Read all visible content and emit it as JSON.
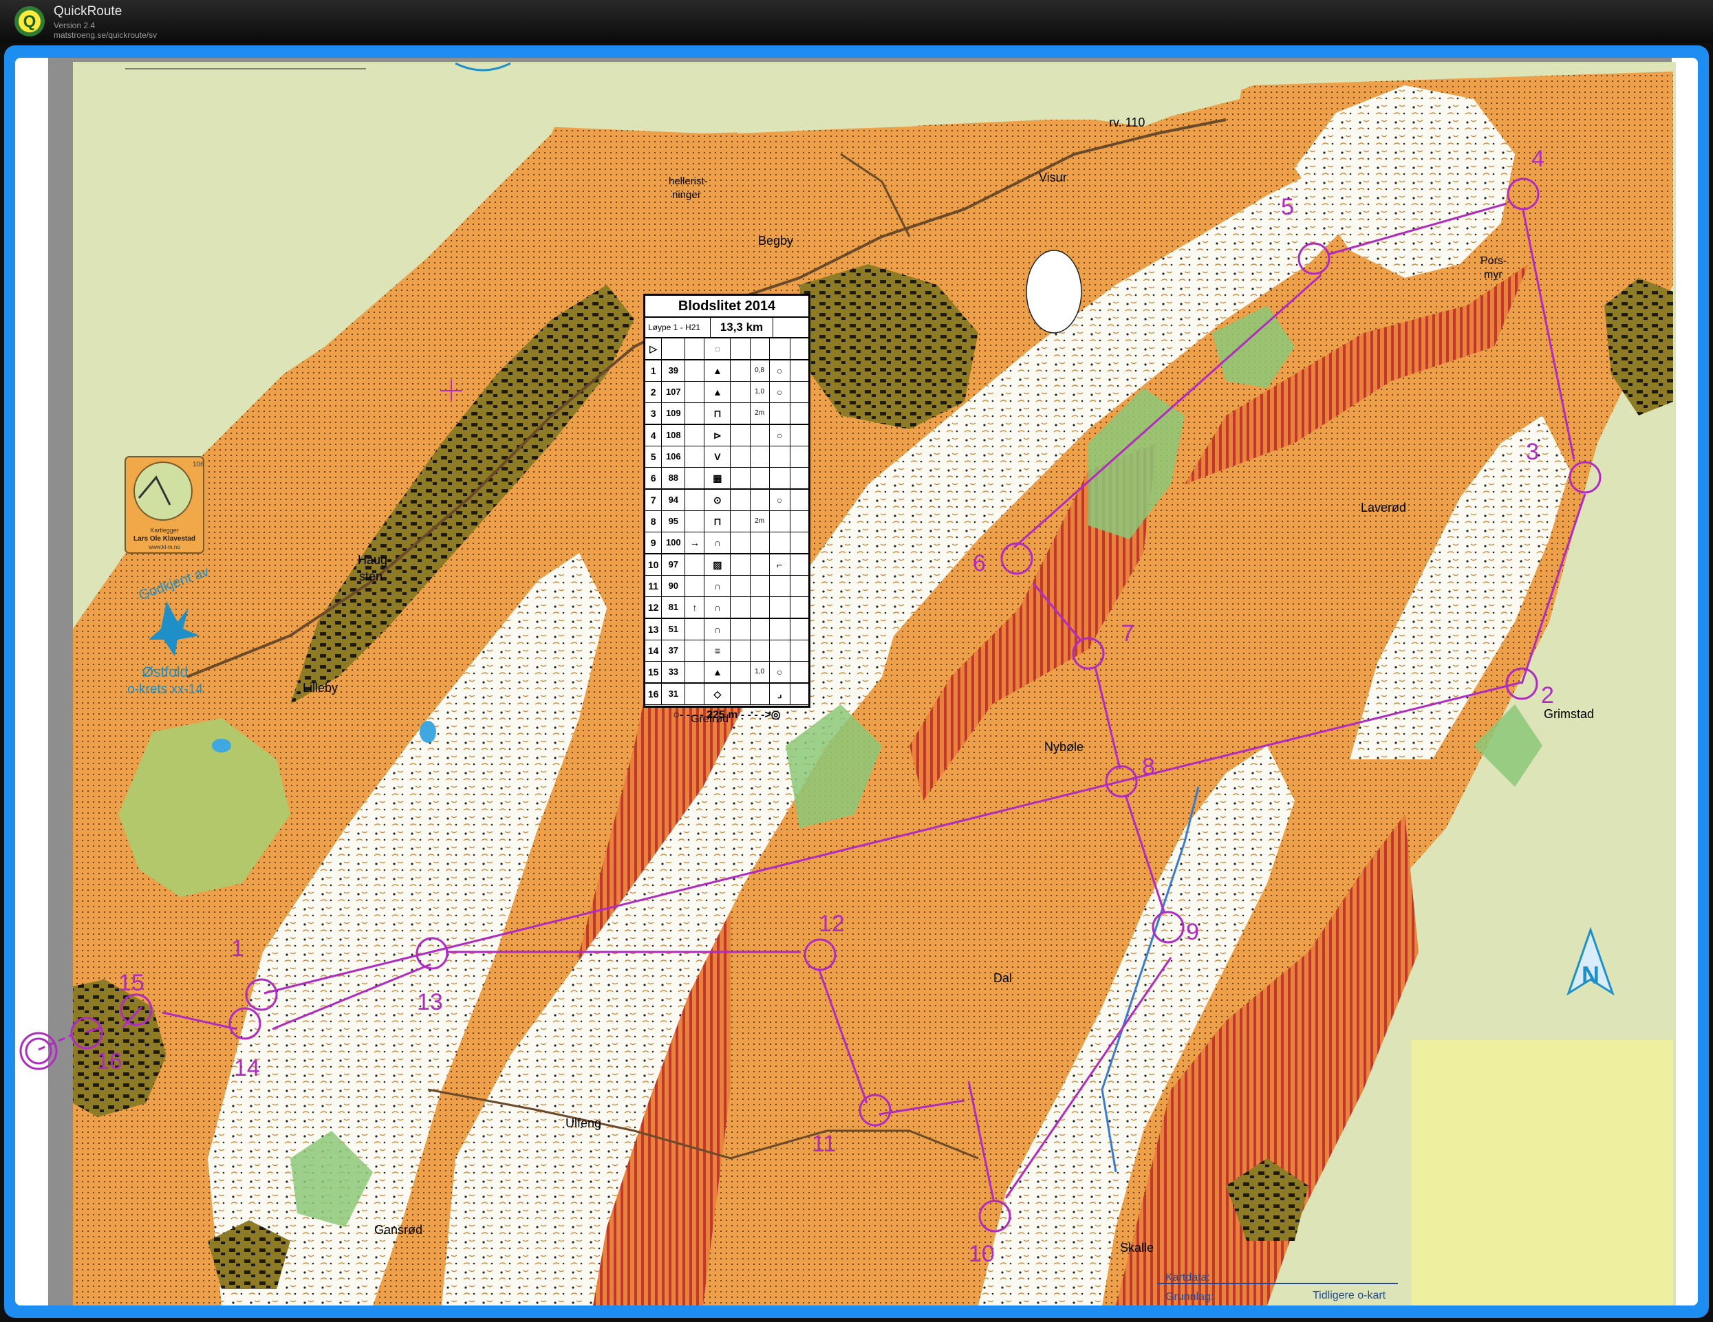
{
  "app": {
    "name": "QuickRoute",
    "version": "Version 2.4",
    "url": "matstroeng.se/quickroute/sv",
    "logo_letter": "Q"
  },
  "map": {
    "place_names": {
      "hellerist": "hellerist-",
      "ninger": "ninger",
      "rv110": "rv. 110",
      "visur": "Visur",
      "begby": "Begby",
      "pors": "Pors-",
      "myr": "myr",
      "laverod": "Laverød",
      "haug": "Haug-",
      "sten": "sten",
      "lilleby": "Lilleby",
      "grimstad": "Grimstad",
      "nybole": "Nybøle",
      "dal": "Dal",
      "ulfeng": "Ulfeng",
      "gansrod": "Gansrød",
      "skalle": "Skalle",
      "gretrod": "Grefrød"
    },
    "mapper_logo": {
      "number": "106",
      "line1": "Kartlegger",
      "line2": "Lars Ole Klavestad",
      "line3": "www.kl-m.no"
    },
    "approval": {
      "godkjent": "Godkjent av",
      "ostfold": "Østfold",
      "krets": "o-krets xx-14"
    },
    "north_label": "N",
    "footer": {
      "kartdata": "Kartdata:",
      "grunnlag": "Grunnlag:",
      "tidligere": "Tidligere o-kart"
    },
    "control_labels": [
      "1",
      "2",
      "3",
      "4",
      "5",
      "6",
      "7",
      "8",
      "9",
      "10",
      "11",
      "12",
      "13",
      "14",
      "15",
      "16"
    ],
    "colors": {
      "course": "#b02cc0",
      "open_land": "#f0a848",
      "forest": "#ffffff",
      "green": "#8cc878",
      "olive": "#bfe0a0",
      "out_of_bounds": "#e87a3c"
    }
  },
  "control_descriptions": {
    "title": "Blodslitet 2014",
    "course": "Løype 1 - H21",
    "length": "13,3 km",
    "start_symbol": "▷",
    "rows": [
      {
        "no": "1",
        "code": "39",
        "sym": "▲",
        "dim": "0,8",
        "extra": "○"
      },
      {
        "no": "2",
        "code": "107",
        "sym": "▲",
        "dim": "1,0",
        "extra": "○"
      },
      {
        "no": "3",
        "code": "109",
        "sym": "⊓",
        "dim": "2m",
        "extra": ""
      },
      {
        "no": "4",
        "code": "108",
        "sym": "⊳",
        "dim": "",
        "extra": "○"
      },
      {
        "no": "5",
        "code": "106",
        "sym": "V",
        "dim": "",
        "extra": ""
      },
      {
        "no": "6",
        "code": "88",
        "sym": "▦",
        "dim": "",
        "extra": ""
      },
      {
        "no": "7",
        "code": "94",
        "sym": "⊙",
        "dim": "",
        "extra": "○"
      },
      {
        "no": "8",
        "code": "95",
        "sym": "⊓",
        "dim": "2m",
        "extra": ""
      },
      {
        "no": "9",
        "code": "100",
        "sym": "∩",
        "dim": "",
        "extra": ""
      },
      {
        "no": "10",
        "code": "97",
        "sym": "▨",
        "dim": "",
        "extra": "⌐"
      },
      {
        "no": "11",
        "code": "90",
        "sym": "∩",
        "dim": "",
        "extra": ""
      },
      {
        "no": "12",
        "code": "81",
        "sym": "∩",
        "dim": "",
        "extra": ""
      },
      {
        "no": "13",
        "code": "51",
        "sym": "∩",
        "dim": "",
        "extra": ""
      },
      {
        "no": "14",
        "code": "37",
        "sym": "≡",
        "dim": "",
        "extra": ""
      },
      {
        "no": "15",
        "code": "33",
        "sym": "▲",
        "dim": "1,0",
        "extra": "○"
      },
      {
        "no": "16",
        "code": "31",
        "sym": "◇",
        "dim": "",
        "extra": "⌟"
      }
    ],
    "arrows": {
      "9": "→",
      "12": "↑"
    },
    "finish": "○- - - - 225 m - - - ->◎"
  }
}
